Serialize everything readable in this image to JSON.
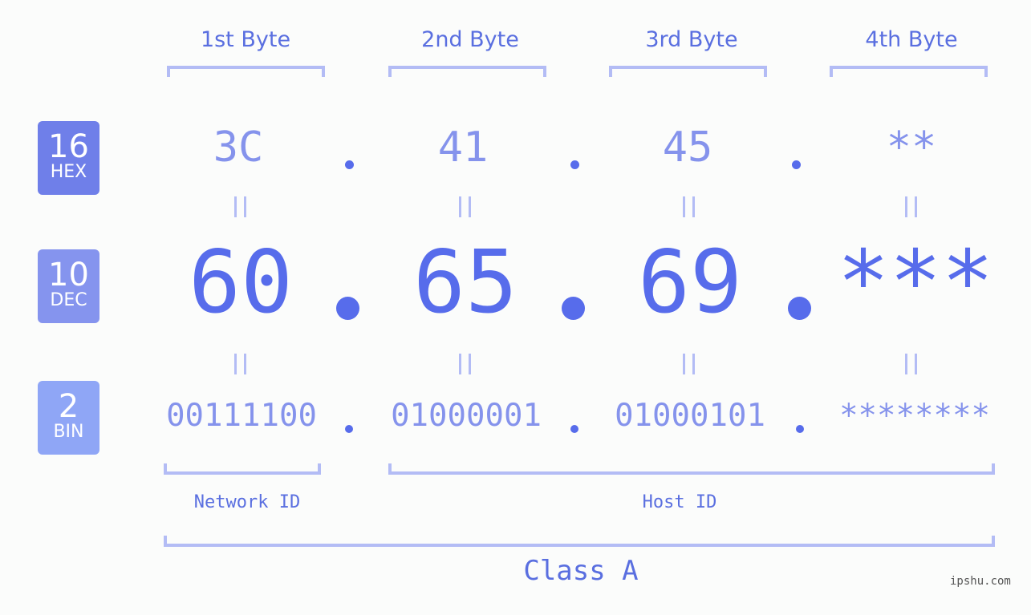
{
  "bytes": [
    {
      "header": "1st Byte",
      "hex": "3C",
      "dec": "60",
      "bin": "00111100"
    },
    {
      "header": "2nd Byte",
      "hex": "41",
      "dec": "65",
      "bin": "01000001"
    },
    {
      "header": "3rd Byte",
      "hex": "45",
      "dec": "69",
      "bin": "01000101"
    },
    {
      "header": "4th Byte",
      "hex": "**",
      "dec": "***",
      "bin": "********"
    }
  ],
  "badges": {
    "hex": {
      "num": "16",
      "label": "HEX",
      "color": "#6f7fe9"
    },
    "dec": {
      "num": "10",
      "label": "DEC",
      "color": "#8594ee"
    },
    "bin": {
      "num": "2",
      "label": "BIN",
      "color": "#8fa6f6"
    }
  },
  "equals_sign": "=",
  "network_label": "Network ID",
  "host_label": "Host ID",
  "class_label": "Class A",
  "watermark": "ipshu.com"
}
